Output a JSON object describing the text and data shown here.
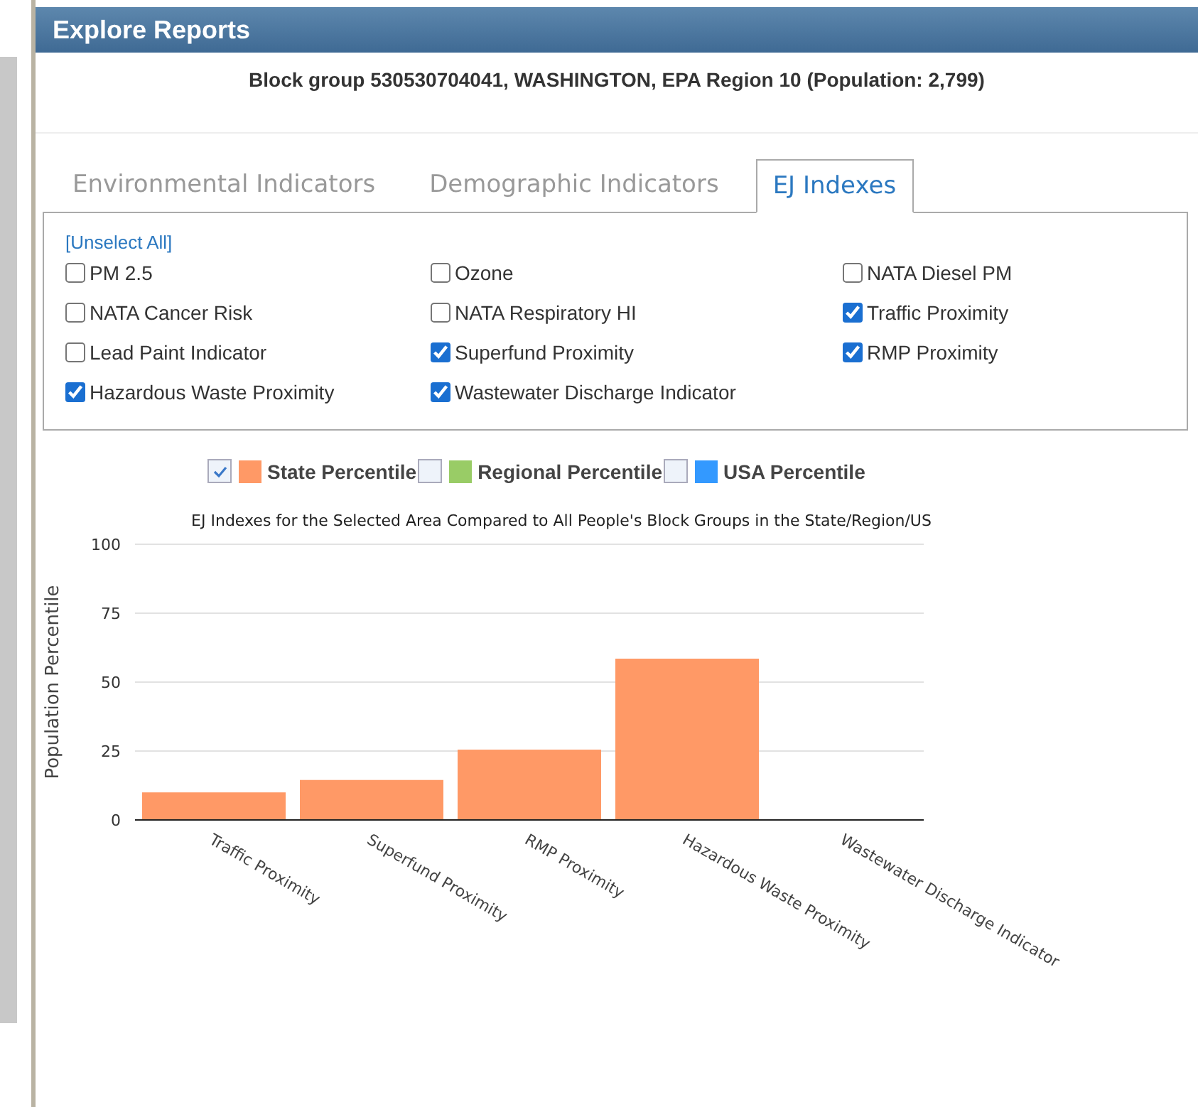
{
  "window": {
    "title": "Explore Reports"
  },
  "location": "Block group 530530704041, WASHINGTON, EPA Region 10 (Population: 2,799)",
  "tabs": [
    {
      "label": "Environmental Indicators",
      "selected": false
    },
    {
      "label": "Demographic Indicators",
      "selected": false
    },
    {
      "label": "EJ Indexes",
      "selected": true
    }
  ],
  "unselect": {
    "open": "[",
    "label": "Unselect All",
    "close": "]"
  },
  "indexes": [
    {
      "label": "PM 2.5",
      "checked": false
    },
    {
      "label": "Ozone",
      "checked": false
    },
    {
      "label": "NATA Diesel PM",
      "checked": false
    },
    {
      "label": "NATA Cancer Risk",
      "checked": false
    },
    {
      "label": "NATA Respiratory HI",
      "checked": false
    },
    {
      "label": "Traffic Proximity",
      "checked": true
    },
    {
      "label": "Lead Paint Indicator",
      "checked": false
    },
    {
      "label": "Superfund Proximity",
      "checked": true
    },
    {
      "label": "RMP Proximity",
      "checked": true
    },
    {
      "label": "Hazardous Waste Proximity",
      "checked": true
    },
    {
      "label": "Wastewater Discharge Indicator",
      "checked": true
    }
  ],
  "legend": [
    {
      "checked": true
    },
    {
      "label": "Regional Percentile",
      "checked": false,
      "color": "#99cc66"
    },
    {
      "label": "USA Percentile",
      "checked": false,
      "color": "#3399ff"
    }
  ],
  "chart": {
    "chart_data": {
      "type": "bar",
      "title": "EJ Indexes for the Selected Area Compared to All People's Block Groups in the State/Region/US",
      "ylabel": "Population Percentile",
      "categories": [
        "Traffic Proximity",
        "Superfund Proximity",
        "RMP Proximity",
        "Hazardous Waste Proximity",
        "Wastewater Discharge Indicator"
      ],
      "series": [
        {
          "name": "State Percentile",
          "color": "#ff9966",
          "values": [
            10,
            14.5,
            25.5,
            58.5,
            0
          ]
        }
      ],
      "ylim": [
        0,
        100
      ],
      "yticks": [
        0,
        25,
        50,
        75,
        100
      ],
      "grid": true
    }
  }
}
